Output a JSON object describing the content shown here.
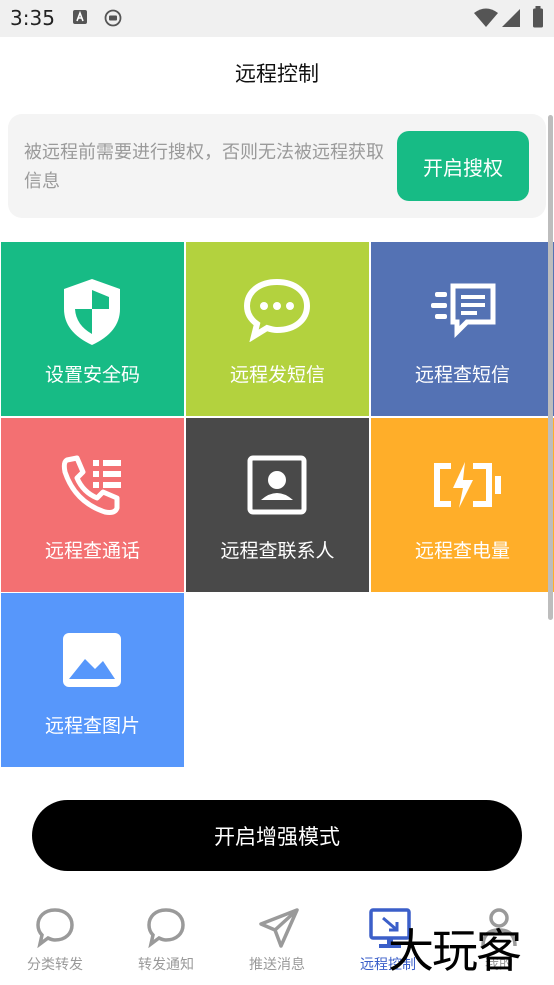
{
  "status_bar": {
    "time": "3:35"
  },
  "header": {
    "title": "远程控制"
  },
  "notice": {
    "text": "被远程前需要进行搜权，否则无法被远程获取信息",
    "button_label": "开启搜权"
  },
  "colors": {
    "green": "#17bb85",
    "lime": "#b3d23e",
    "indigo": "#5472b4",
    "coral": "#f37072",
    "charcoal": "#494949",
    "amber": "#ffae29",
    "blue": "#5797fb",
    "active_nav": "#3b5fc9"
  },
  "tiles": [
    {
      "label": "设置安全码",
      "icon": "shield-icon",
      "color": "#17bb85"
    },
    {
      "label": "远程发短信",
      "icon": "chat-bubble-icon",
      "color": "#b3d23e"
    },
    {
      "label": "远程查短信",
      "icon": "message-list-icon",
      "color": "#5472b4"
    },
    {
      "label": "远程查通话",
      "icon": "phone-log-icon",
      "color": "#f37072"
    },
    {
      "label": "远程查联系人",
      "icon": "contact-card-icon",
      "color": "#494949"
    },
    {
      "label": "远程查电量",
      "icon": "battery-charging-icon",
      "color": "#ffae29"
    },
    {
      "label": "远程查图片",
      "icon": "image-icon",
      "color": "#5797fb"
    }
  ],
  "enhance_button": {
    "label": "开启增强模式"
  },
  "bottom_nav": [
    {
      "label": "分类转发",
      "icon": "chat-outline-icon",
      "active": false
    },
    {
      "label": "转发通知",
      "icon": "chat-outline-icon",
      "active": false
    },
    {
      "label": "推送消息",
      "icon": "send-icon",
      "active": false
    },
    {
      "label": "远程控制",
      "icon": "remote-desktop-icon",
      "active": true
    },
    {
      "label": "我的",
      "icon": "person-icon",
      "active": false
    }
  ]
}
